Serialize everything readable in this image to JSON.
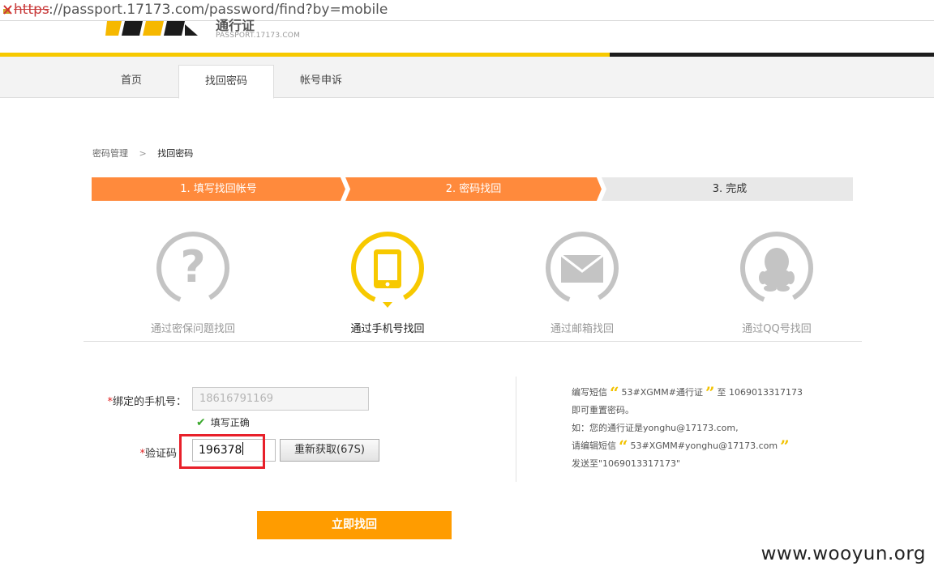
{
  "browser": {
    "url_scheme": "https",
    "url_rest": "://passport.17173.com/password/find?by=mobile"
  },
  "header": {
    "logo_subtitle": "PASSPORT.17173.COM",
    "logo_title": "通行证"
  },
  "nav": {
    "items": [
      {
        "label": "首页"
      },
      {
        "label": "找回密码"
      },
      {
        "label": "帐号申诉"
      }
    ]
  },
  "breadcrumb": {
    "parent": "密码管理",
    "separator": ">",
    "current": "找回密码"
  },
  "steps": [
    {
      "label": "1. 填写找回帐号"
    },
    {
      "label": "2. 密码找回"
    },
    {
      "label": "3. 完成"
    }
  ],
  "methods": [
    {
      "label": "通过密保问题找回",
      "icon": "question-icon"
    },
    {
      "label": "通过手机号找回",
      "icon": "mobile-icon"
    },
    {
      "label": "通过邮箱找回",
      "icon": "mail-icon"
    },
    {
      "label": "通过QQ号找回",
      "icon": "qq-icon"
    }
  ],
  "form": {
    "required_mark": "*",
    "phone_label": "绑定的手机号：",
    "phone_value": "18616791169",
    "phone_ok": "填写正确",
    "code_label": "验证码",
    "code_value": "196378",
    "resend_label": "重新获取(67S)",
    "submit_label": "立即找回"
  },
  "info": {
    "line1_prefix": "编写短信",
    "line1_code": "53#XGMM#通行证",
    "line1_to": "至 1069013317173",
    "line2": "即可重置密码。",
    "line3": "如：您的通行证是yonghu@17173.com,",
    "line4_prefix": "请编辑短信",
    "line4_code": "53#XGMM#yonghu@17173.com",
    "line5": "发送至\"1069013317173\"",
    "quote_open": "“",
    "quote_close": "”"
  },
  "watermark": "www.wooyun.org",
  "colors": {
    "step_active": "#ff8a3c",
    "step_inactive": "#e8e8e8",
    "accent_yellow": "#f7c900",
    "submit": "#ff9c00"
  }
}
